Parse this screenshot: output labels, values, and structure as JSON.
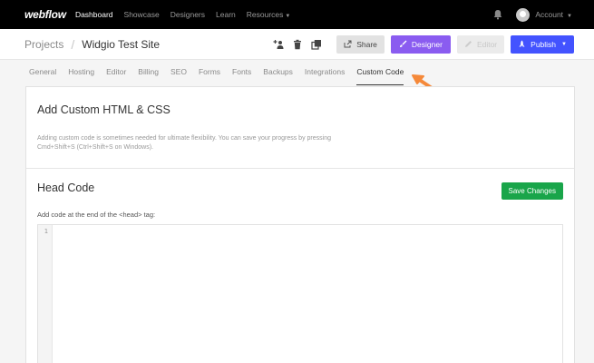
{
  "topnav": {
    "logo": "webflow",
    "links": [
      "Dashboard",
      "Showcase",
      "Designers",
      "Learn",
      "Resources"
    ],
    "account_label": "Account",
    "icons": [
      "bell-icon",
      "avatar",
      "chevron-down-icon"
    ]
  },
  "header": {
    "breadcrumb_root": "Projects",
    "breadcrumb_sep": "/",
    "site_name": "Widgio Test Site",
    "icons": [
      "add-user-icon",
      "trash-icon",
      "duplicate-icon"
    ],
    "buttons": {
      "share": "Share",
      "designer": "Designer",
      "editor": "Editor",
      "publish": "Publish"
    }
  },
  "tabs": [
    "General",
    "Hosting",
    "Editor",
    "Billing",
    "SEO",
    "Forms",
    "Fonts",
    "Backups",
    "Integrations",
    "Custom Code"
  ],
  "active_tab": "Custom Code",
  "custom_html": {
    "title": "Add Custom HTML & CSS",
    "description": "Adding custom code is sometimes needed for ultimate flexibility. You can save your progress by pressing Cmd+Shift+S (Ctrl+Shift+S on Windows)."
  },
  "head_code": {
    "title": "Head Code",
    "save_button": "Save Changes",
    "label": "Add code at the end of the <head> tag:",
    "line_number": "1"
  },
  "colors": {
    "designer": "#8a5cf0",
    "publish": "#4353ff",
    "save": "#19a54a",
    "arrow": "#f5893a"
  }
}
